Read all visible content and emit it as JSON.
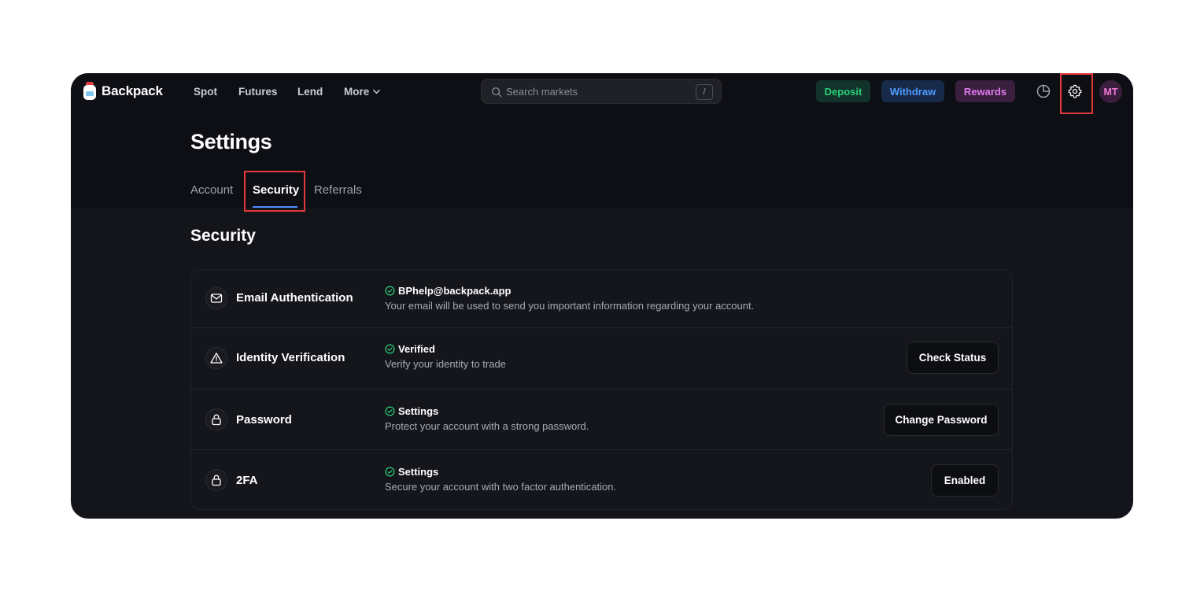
{
  "brand": {
    "name": "Backpack"
  },
  "nav": {
    "links": [
      "Spot",
      "Futures",
      "Lend"
    ],
    "more_label": "More"
  },
  "search": {
    "placeholder": "Search markets",
    "shortcut": "/"
  },
  "actions": {
    "deposit": "Deposit",
    "withdraw": "Withdraw",
    "rewards": "Rewards"
  },
  "user": {
    "initials": "MT"
  },
  "page": {
    "title": "Settings",
    "tabs": [
      "Account",
      "Security",
      "Referrals"
    ],
    "active_tab": "Security"
  },
  "security": {
    "title": "Security",
    "rows": [
      {
        "icon": "mail-icon",
        "title": "Email Authentication",
        "status": "BPhelp@backpack.app",
        "description": "Your email will be used to send you important information regarding your account.",
        "button": ""
      },
      {
        "icon": "warning-icon",
        "title": "Identity Verification",
        "status": "Verified",
        "description": "Verify your identity to trade",
        "button": "Check Status"
      },
      {
        "icon": "lock-icon",
        "title": "Password",
        "status": "Settings",
        "description": "Protect your account with a strong password.",
        "button": "Change Password"
      },
      {
        "icon": "lock-icon",
        "title": "2FA",
        "status": "Settings",
        "description": "Secure your account with two factor authentication.",
        "button": "Enabled"
      }
    ]
  },
  "colors": {
    "app_bg": "#14151b",
    "header_bg": "#0e0f14",
    "deposit": "#2ad07b",
    "withdraw": "#4f9cff",
    "rewards": "#e07af0",
    "status_check": "#2ad07b",
    "highlight": "#e23a3a"
  }
}
